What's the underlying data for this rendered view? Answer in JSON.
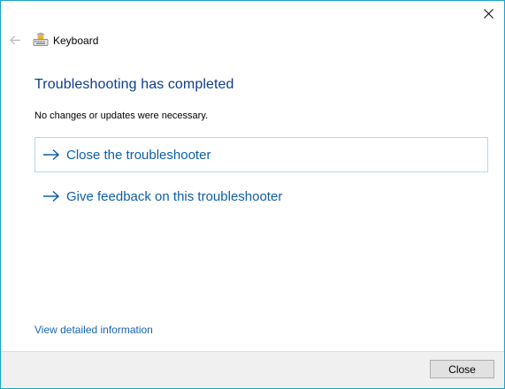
{
  "window": {
    "app_title": "Keyboard",
    "accent_color": "#1aa3c8"
  },
  "icons": {
    "close": "close-icon",
    "back": "back-arrow-icon",
    "app": "keyboard-icon",
    "link_arrow": "right-arrow-icon"
  },
  "content": {
    "heading": "Troubleshooting has completed",
    "message": "No changes or updates were necessary.",
    "links": [
      {
        "label": "Close the troubleshooter"
      },
      {
        "label": "Give feedback on this troubleshooter"
      }
    ],
    "details_link": "View detailed information"
  },
  "footer": {
    "close_label": "Close"
  }
}
